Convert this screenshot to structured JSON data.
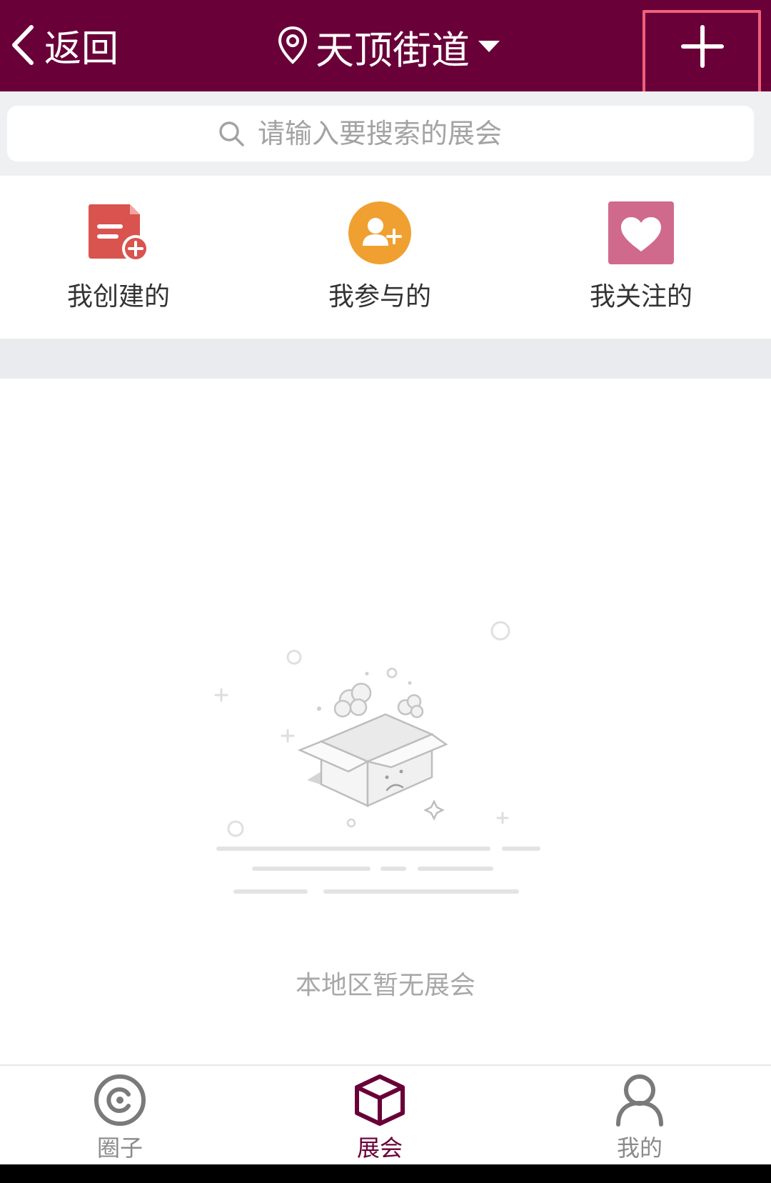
{
  "header": {
    "back_label": "返回",
    "location_label": "天顶街道"
  },
  "search": {
    "placeholder": "请输入要搜索的展会"
  },
  "quick_menu": [
    {
      "label": "我创建的",
      "icon": "create-doc-icon",
      "color": "#d9534f"
    },
    {
      "label": "我参与的",
      "icon": "add-user-icon",
      "color": "#f0a030"
    },
    {
      "label": "我关注的",
      "icon": "heart-icon",
      "color": "#d06a8c"
    }
  ],
  "empty_state": {
    "message": "本地区暂无展会",
    "icon": "empty-box-icon"
  },
  "tabbar": {
    "items": [
      {
        "label": "圈子",
        "icon": "circle-icon"
      },
      {
        "label": "展会",
        "icon": "cube-icon",
        "active": true
      },
      {
        "label": "我的",
        "icon": "person-icon"
      }
    ]
  },
  "colors": {
    "header_bg": "#690038",
    "accent": "#690038",
    "highlight_border": "#f0607a"
  }
}
